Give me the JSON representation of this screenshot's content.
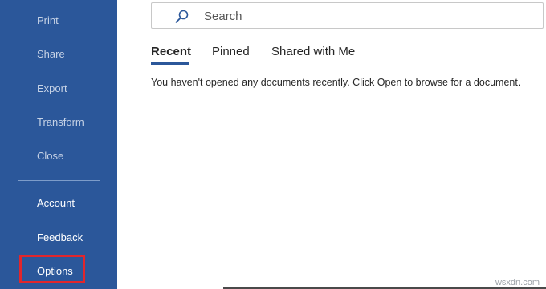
{
  "sidebar": {
    "items": [
      {
        "label": "Print"
      },
      {
        "label": "Share"
      },
      {
        "label": "Export"
      },
      {
        "label": "Transform"
      },
      {
        "label": "Close"
      },
      {
        "label": "Account"
      },
      {
        "label": "Feedback"
      },
      {
        "label": "Options"
      }
    ]
  },
  "search": {
    "placeholder": "Search"
  },
  "tabs": [
    {
      "label": "Recent",
      "active": true
    },
    {
      "label": "Pinned",
      "active": false
    },
    {
      "label": "Shared with Me",
      "active": false
    }
  ],
  "recent": {
    "empty_message": "You haven't opened any documents recently. Click Open to browse for a document."
  },
  "watermark": "wsxdn.com",
  "colors": {
    "sidebar_bg": "#2b579a",
    "highlight_border": "#e1262c",
    "tab_underline": "#2b579a"
  }
}
